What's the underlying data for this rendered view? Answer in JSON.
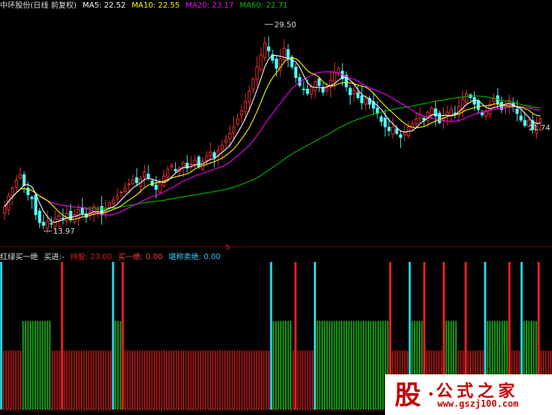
{
  "header_top": {
    "title": "中环股份(日线 前复权)",
    "ma5": "MA5: 22.52",
    "ma10": "MA10: 22.55",
    "ma20": "MA20: 23.17",
    "ma60": "MA60: 22.71",
    "colors": {
      "title": "#e0e0e0",
      "ma5": "#ffffff",
      "ma10": "#ffff00",
      "ma20": "#ff00ff",
      "ma60": "#00c000"
    }
  },
  "header_bottom": {
    "name": "红绿买一绝",
    "buy_label": "买进:-",
    "hold": "持股: 23.00",
    "buy_one": "买一绝: 0.00",
    "sell": "堪称卖绝: 0.00",
    "colors": {
      "name": "#e0e0e0",
      "hold": "#e02020",
      "buy_one": "#ff4040",
      "sell": "#40c8ff"
    }
  },
  "logo": {
    "badge": "股",
    "name": "公式之家",
    "url": "www.gszj100.com"
  },
  "chart_data": [
    {
      "type": "candlestick",
      "title": "中环股份(日线 前复权)",
      "annotations": {
        "high": 29.5,
        "low": 13.97,
        "last": 21.74,
        "marker": "5"
      },
      "ylim": [
        13.2,
        30.5
      ],
      "colors": {
        "up": "#ff3232",
        "down": "#54ffff",
        "ma5": "#ffffff",
        "ma10": "#ffff00",
        "ma20": "#ff00ff",
        "ma60": "#00c000"
      },
      "close": [
        15.8,
        16.6,
        17.2,
        17.8,
        18.2,
        17.4,
        16.7,
        16.4,
        15.2,
        14.6,
        14.4,
        14.7,
        14.5,
        14.9,
        15.1,
        14.9,
        15.3,
        14.8,
        15.2,
        15.6,
        15.3,
        15.0,
        15.4,
        15.8,
        15.6,
        15.2,
        15.7,
        16.1,
        16.3,
        16.6,
        16.9,
        17.2,
        17.5,
        17.8,
        17.6,
        17.9,
        18.4,
        18.0,
        17.4,
        17.1,
        17.5,
        18.1,
        18.6,
        18.9,
        18.5,
        18.7,
        19.1,
        18.7,
        19.0,
        19.3,
        18.8,
        19.2,
        19.6,
        19.9,
        19.5,
        20.0,
        20.4,
        20.8,
        21.3,
        21.8,
        22.4,
        23.0,
        23.7,
        24.5,
        25.4,
        26.3,
        27.2,
        28.1,
        27.5,
        26.8,
        26.2,
        26.9,
        27.7,
        27.0,
        26.3,
        25.5,
        24.9,
        24.6,
        24.3,
        24.8,
        25.2,
        24.9,
        24.4,
        24.7,
        25.3,
        25.9,
        26.2,
        25.4,
        24.8,
        24.2,
        24.5,
        24.0,
        23.6,
        23.9,
        23.5,
        23.2,
        22.8,
        22.2,
        21.8,
        21.5,
        21.8,
        21.3,
        21.0,
        21.4,
        21.8,
        22.0,
        22.4,
        22.7,
        22.3,
        22.9,
        23.2,
        22.6,
        22.1,
        22.5,
        22.9,
        23.1,
        22.8,
        23.3,
        23.9,
        24.3,
        24.0,
        23.5,
        23.1,
        22.7,
        23.0,
        23.5,
        23.9,
        23.5,
        23.1,
        23.5,
        23.8,
        23.3,
        22.8,
        22.3,
        21.9,
        22.3,
        21.6,
        22.1,
        22.4
      ],
      "ma_series": [
        {
          "name": "MA5",
          "value": 22.52
        },
        {
          "name": "MA10",
          "value": 22.55
        },
        {
          "name": "MA20",
          "value": 23.17
        },
        {
          "name": "MA60",
          "value": 22.71
        }
      ]
    },
    {
      "type": "bar",
      "title": "红绿买一绝",
      "levels": {
        "full": 1.0,
        "green": 0.6,
        "red": 0.4
      },
      "colors": {
        "red": "#b01818",
        "green": "#18b018",
        "red_signal": "#ff2020",
        "cyan_signal": "#30e0f0",
        "dots": "#b8b8b8"
      },
      "segments": [
        [
          "cyan",
          1
        ],
        [
          "red",
          8
        ],
        [
          "green",
          12
        ],
        [
          "red",
          1
        ],
        [
          "red",
          3
        ],
        [
          "red_signal",
          1
        ],
        [
          "red",
          20
        ],
        [
          "cyan",
          1
        ],
        [
          "green",
          3
        ],
        [
          "red_signal",
          1
        ],
        [
          "red",
          60
        ],
        [
          "cyan",
          1
        ],
        [
          "green",
          8
        ],
        [
          "red",
          1
        ],
        [
          "red_signal",
          1
        ],
        [
          "red",
          7
        ],
        [
          "cyan",
          1
        ],
        [
          "green",
          30
        ],
        [
          "red_signal",
          1
        ],
        [
          "red",
          7
        ],
        [
          "cyan",
          1
        ],
        [
          "green",
          5
        ],
        [
          "red_signal",
          1
        ],
        [
          "red",
          7
        ],
        [
          "red_signal",
          1
        ],
        [
          "green",
          5
        ],
        [
          "red",
          3
        ],
        [
          "red_signal",
          1
        ],
        [
          "red",
          7
        ],
        [
          "cyan",
          1
        ],
        [
          "green",
          9
        ],
        [
          "red_signal",
          1
        ],
        [
          "red",
          4
        ],
        [
          "cyan",
          1
        ],
        [
          "green",
          6
        ],
        [
          "red_signal",
          1
        ],
        [
          "red",
          5
        ]
      ]
    }
  ]
}
